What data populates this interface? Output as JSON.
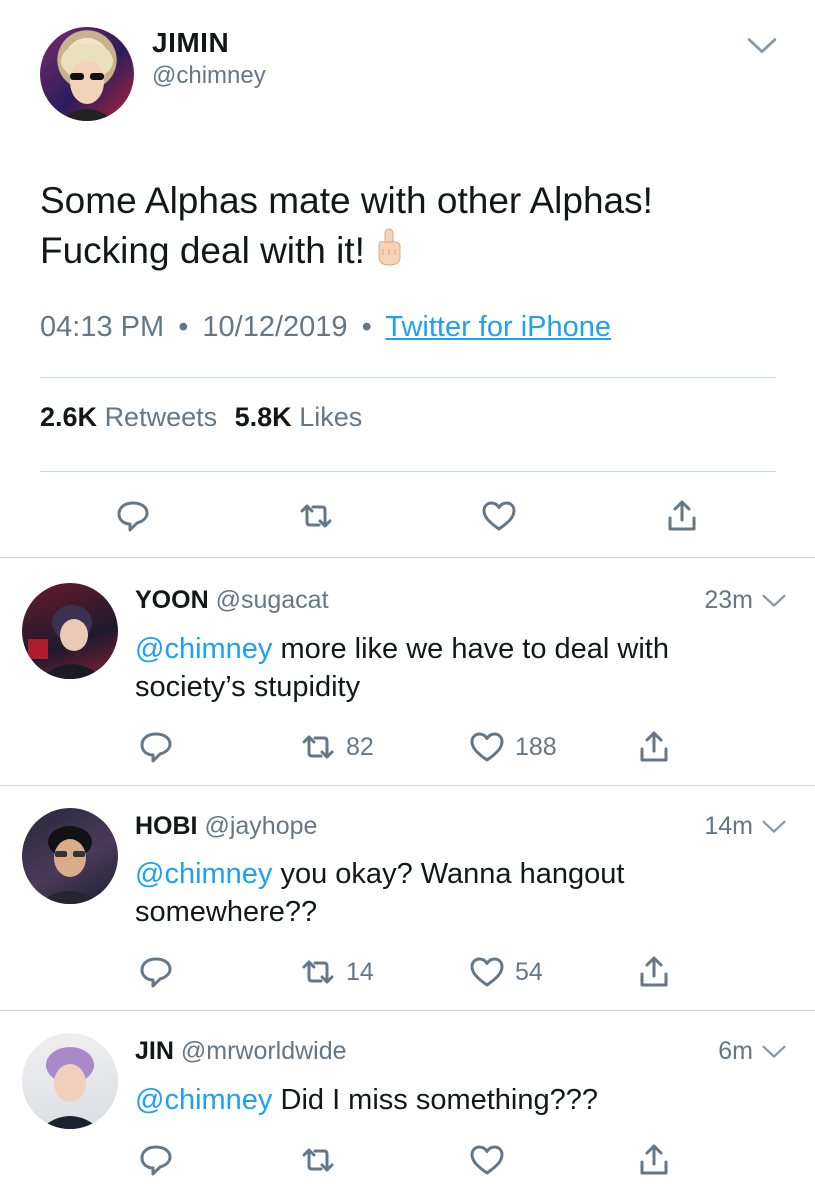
{
  "main_tweet": {
    "name": "JIMIN",
    "handle": "@chimney",
    "text_line1": "Some Alphas mate with other Alphas!",
    "text_line2": "Fucking deal with it!",
    "emoji": "middle-finger",
    "time": "04:13 PM",
    "sep1": "•",
    "date": "10/12/2019",
    "sep2": "•",
    "source": "Twitter for iPhone",
    "retweets_count": "2.6K",
    "retweets_label": "Retweets",
    "likes_count": "5.8K",
    "likes_label": "Likes"
  },
  "replies": [
    {
      "name": "YOON",
      "handle": "@sugacat",
      "time": "23m",
      "mention": "@chimney",
      "text": " more like we have to deal with society’s stupidity",
      "retweets": "82",
      "likes": "188"
    },
    {
      "name": "HOBI",
      "handle": "@jayhope",
      "time": "14m",
      "mention": "@chimney",
      "text": " you okay? Wanna hangout somewhere??",
      "retweets": "14",
      "likes": "54"
    },
    {
      "name": "JIN",
      "handle": "@mrworldwide",
      "time": "6m",
      "mention": "@chimney",
      "text": " Did I miss something???",
      "retweets": "",
      "likes": ""
    }
  ],
  "icons": {
    "reply": "reply-icon",
    "retweet": "retweet-icon",
    "like": "heart-icon",
    "share": "share-icon",
    "menu": "chevron-down-icon"
  },
  "colors": {
    "accent": "#1da1f2",
    "muted": "#657786",
    "text": "#14171a",
    "divider": "#ccd6dd"
  }
}
